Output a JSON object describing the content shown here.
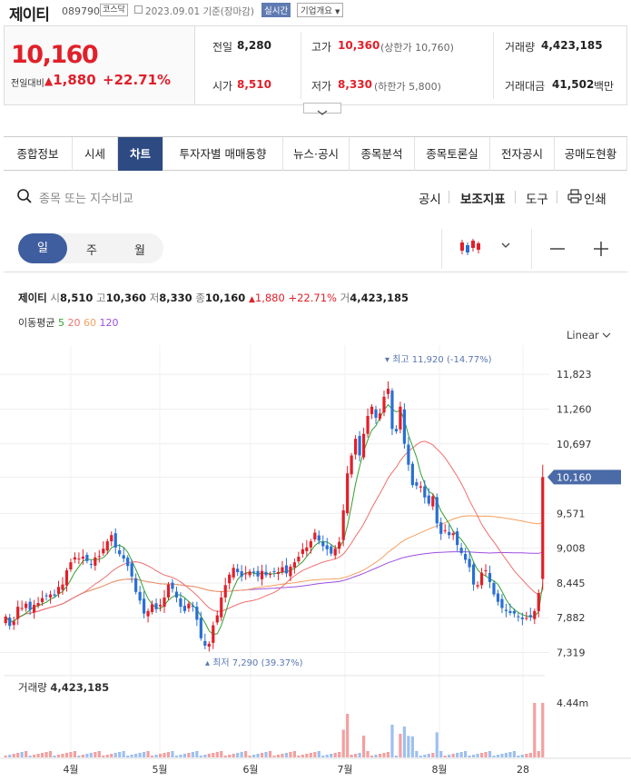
{
  "header": {
    "stock_name": "제이티",
    "stock_code": "089790",
    "market_badge": "코스닥",
    "date_text": "2023.09.01 기준(장마감)",
    "realtime_button": "실시간",
    "company_overview_button": "기업개요"
  },
  "quote": {
    "price": "10,160",
    "prev_label": "전일대비",
    "change": "1,880",
    "change_pct": "+22.71%",
    "prev_close_label": "전일",
    "prev_close": "8,280",
    "open_label": "시가",
    "open": "8,510",
    "high_label": "고가",
    "high": "10,360",
    "upper_limit": "(상한가 10,760)",
    "low_label": "저가",
    "low": "8,330",
    "lower_limit": "(하한가 5,800)",
    "volume_label": "거래량",
    "volume": "4,423,185",
    "value_label": "거래대금",
    "value": "41,502",
    "value_unit": "백만"
  },
  "tabs": [
    "종합정보",
    "시세",
    "차트",
    "투자자별 매매동향",
    "뉴스·공시",
    "종목분석",
    "종목토론실",
    "전자공시",
    "공매도현황"
  ],
  "active_tab": "차트",
  "toolbar": {
    "search_placeholder": "종목 또는 지수비교",
    "disclosure": "공시",
    "indicator": "보조지표",
    "tools": "도구",
    "print": "인쇄"
  },
  "period": {
    "day": "일",
    "week": "주",
    "month": "월"
  },
  "info_line": {
    "name": "제이티",
    "open_l": "시",
    "open": "8,510",
    "high_l": "고",
    "high": "10,360",
    "low_l": "저",
    "low": "8,330",
    "close_l": "종",
    "close": "10,160",
    "change": "1,880",
    "change_pct": "+22.71%",
    "vol_l": "거",
    "vol": "4,423,185"
  },
  "ma_legend": {
    "label": "이동평균",
    "ma5": "5",
    "ma20": "20",
    "ma60": "60",
    "ma120": "120"
  },
  "scale_select": "Linear",
  "colors": {
    "up": "#e0202a",
    "down": "#2a6fd3",
    "ma5": "#2fa12f",
    "ma20": "#ef6f6f",
    "ma60": "#f3a05f",
    "ma120": "#9c4fe0",
    "accent": "#3f5ea0"
  },
  "chart_data": {
    "type": "candlestick",
    "y_ticks": [
      "11,823",
      "11,260",
      "10,697",
      "10,160",
      "9,571",
      "9,008",
      "8,445",
      "7,882",
      "7,319"
    ],
    "ylim": [
      7150,
      12150
    ],
    "x_ticks": [
      "4월",
      "5월",
      "6월",
      "7월",
      "8월",
      "28"
    ],
    "last_price_label": "10,160",
    "max_marker": "최고 11,920 (-14.77%)",
    "min_marker": "최저 7,290 (39.37%)",
    "volume_label": "거래량",
    "volume_value": "4,423,185",
    "volume_axis_tick": "4.44m",
    "closes": [
      7900,
      7750,
      7820,
      8060,
      8040,
      8110,
      8010,
      8090,
      8120,
      8200,
      8240,
      8260,
      8240,
      8380,
      8420,
      8650,
      8780,
      8860,
      8840,
      8870,
      8800,
      8740,
      8860,
      8880,
      9000,
      9120,
      9220,
      9020,
      8910,
      8840,
      8720,
      8550,
      8300,
      8160,
      7950,
      7990,
      8100,
      8020,
      8090,
      8210,
      8420,
      8350,
      8210,
      8060,
      7990,
      8110,
      8060,
      7850,
      7550,
      7430,
      7460,
      7760,
      7920,
      8210,
      8410,
      8580,
      8690,
      8620,
      8550,
      8600,
      8630,
      8610,
      8550,
      8640,
      8570,
      8590,
      8620,
      8620,
      8700,
      8600,
      8710,
      8780,
      8870,
      8990,
      9020,
      9120,
      9260,
      9130,
      9040,
      8990,
      8920,
      9000,
      9110,
      9620,
      10220,
      10510,
      10780,
      10510,
      10860,
      11150,
      11300,
      11120,
      11190,
      11460,
      11590,
      10940,
      10900,
      11300,
      10700,
      10360,
      10030,
      10020,
      10010,
      9830,
      9730,
      9850,
      9410,
      9240,
      9300,
      9220,
      9250,
      9060,
      8930,
      8820,
      8700,
      8420,
      8410,
      8610,
      8650,
      8460,
      8260,
      8140,
      8040,
      7990,
      7960,
      7950,
      7900,
      7860,
      7880,
      7890,
      7990,
      8280,
      10160
    ]
  }
}
